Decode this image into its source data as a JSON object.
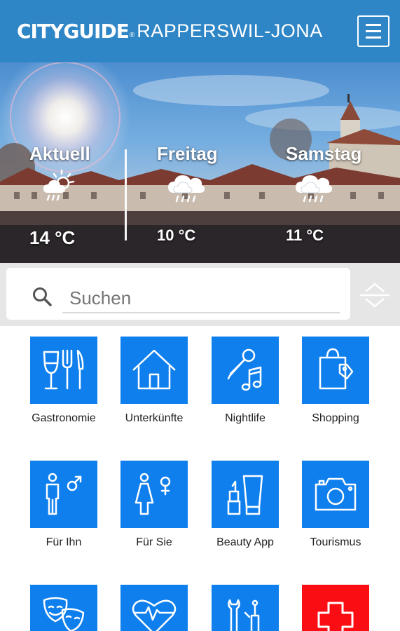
{
  "header": {
    "brand": "CITYGUIDE",
    "reg": "®",
    "city": "RAPPERSWIL-JONA"
  },
  "weather": [
    {
      "day": "Aktuell",
      "temp": "14 °C",
      "icon": "partly-cloudy-rain-icon"
    },
    {
      "day": "Freitag",
      "temp": "10 °C",
      "icon": "cloud-rain-icon"
    },
    {
      "day": "Samstag",
      "temp": "11 °C",
      "icon": "cloud-rain-icon"
    }
  ],
  "search": {
    "placeholder": "Suchen"
  },
  "categories": [
    {
      "label": "Gastronomie",
      "icon": "glass-fork-knife-icon",
      "color": "#0f7fed"
    },
    {
      "label": "Unterkünfte",
      "icon": "house-icon",
      "color": "#0f7fed"
    },
    {
      "label": "Nightlife",
      "icon": "microphone-note-icon",
      "color": "#0f7fed"
    },
    {
      "label": "Shopping",
      "icon": "shopping-bag-icon",
      "color": "#0f7fed"
    },
    {
      "label": "Für Ihn",
      "icon": "male-icon",
      "color": "#0f7fed"
    },
    {
      "label": "Für Sie",
      "icon": "female-icon",
      "color": "#0f7fed"
    },
    {
      "label": "Beauty App",
      "icon": "cosmetics-icon",
      "color": "#0f7fed"
    },
    {
      "label": "Tourismus",
      "icon": "camera-icon",
      "color": "#0f7fed"
    },
    {
      "label": "",
      "icon": "theater-masks-icon",
      "color": "#0f7fed"
    },
    {
      "label": "",
      "icon": "heart-pulse-icon",
      "color": "#0f7fed"
    },
    {
      "label": "",
      "icon": "tools-icon",
      "color": "#0f7fed"
    },
    {
      "label": "",
      "icon": "medical-cross-icon",
      "color": "#fb0e13"
    }
  ],
  "colors": {
    "header": "#2f86c6",
    "tile": "#0f7fed",
    "emergency": "#fb0e13"
  }
}
